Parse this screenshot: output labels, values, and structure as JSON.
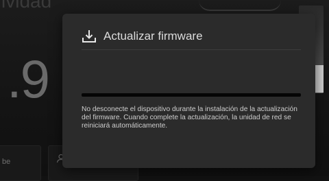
{
  "background": {
    "top_text": "ividad",
    "big_number": ".9",
    "tile_text": "be"
  },
  "dialog": {
    "title": "Actualizar firmware",
    "icon": "download-icon",
    "progress": 0,
    "message": "No desconecte el dispositivo durante la instalación de la actualización del firmware. Cuando complete la actualización, la unidad de red se reiniciará automáticamente."
  },
  "colors": {
    "dialog_bg": "#2b2b2b",
    "title_text": "#dcdcdc",
    "progress_track": "#050505"
  }
}
